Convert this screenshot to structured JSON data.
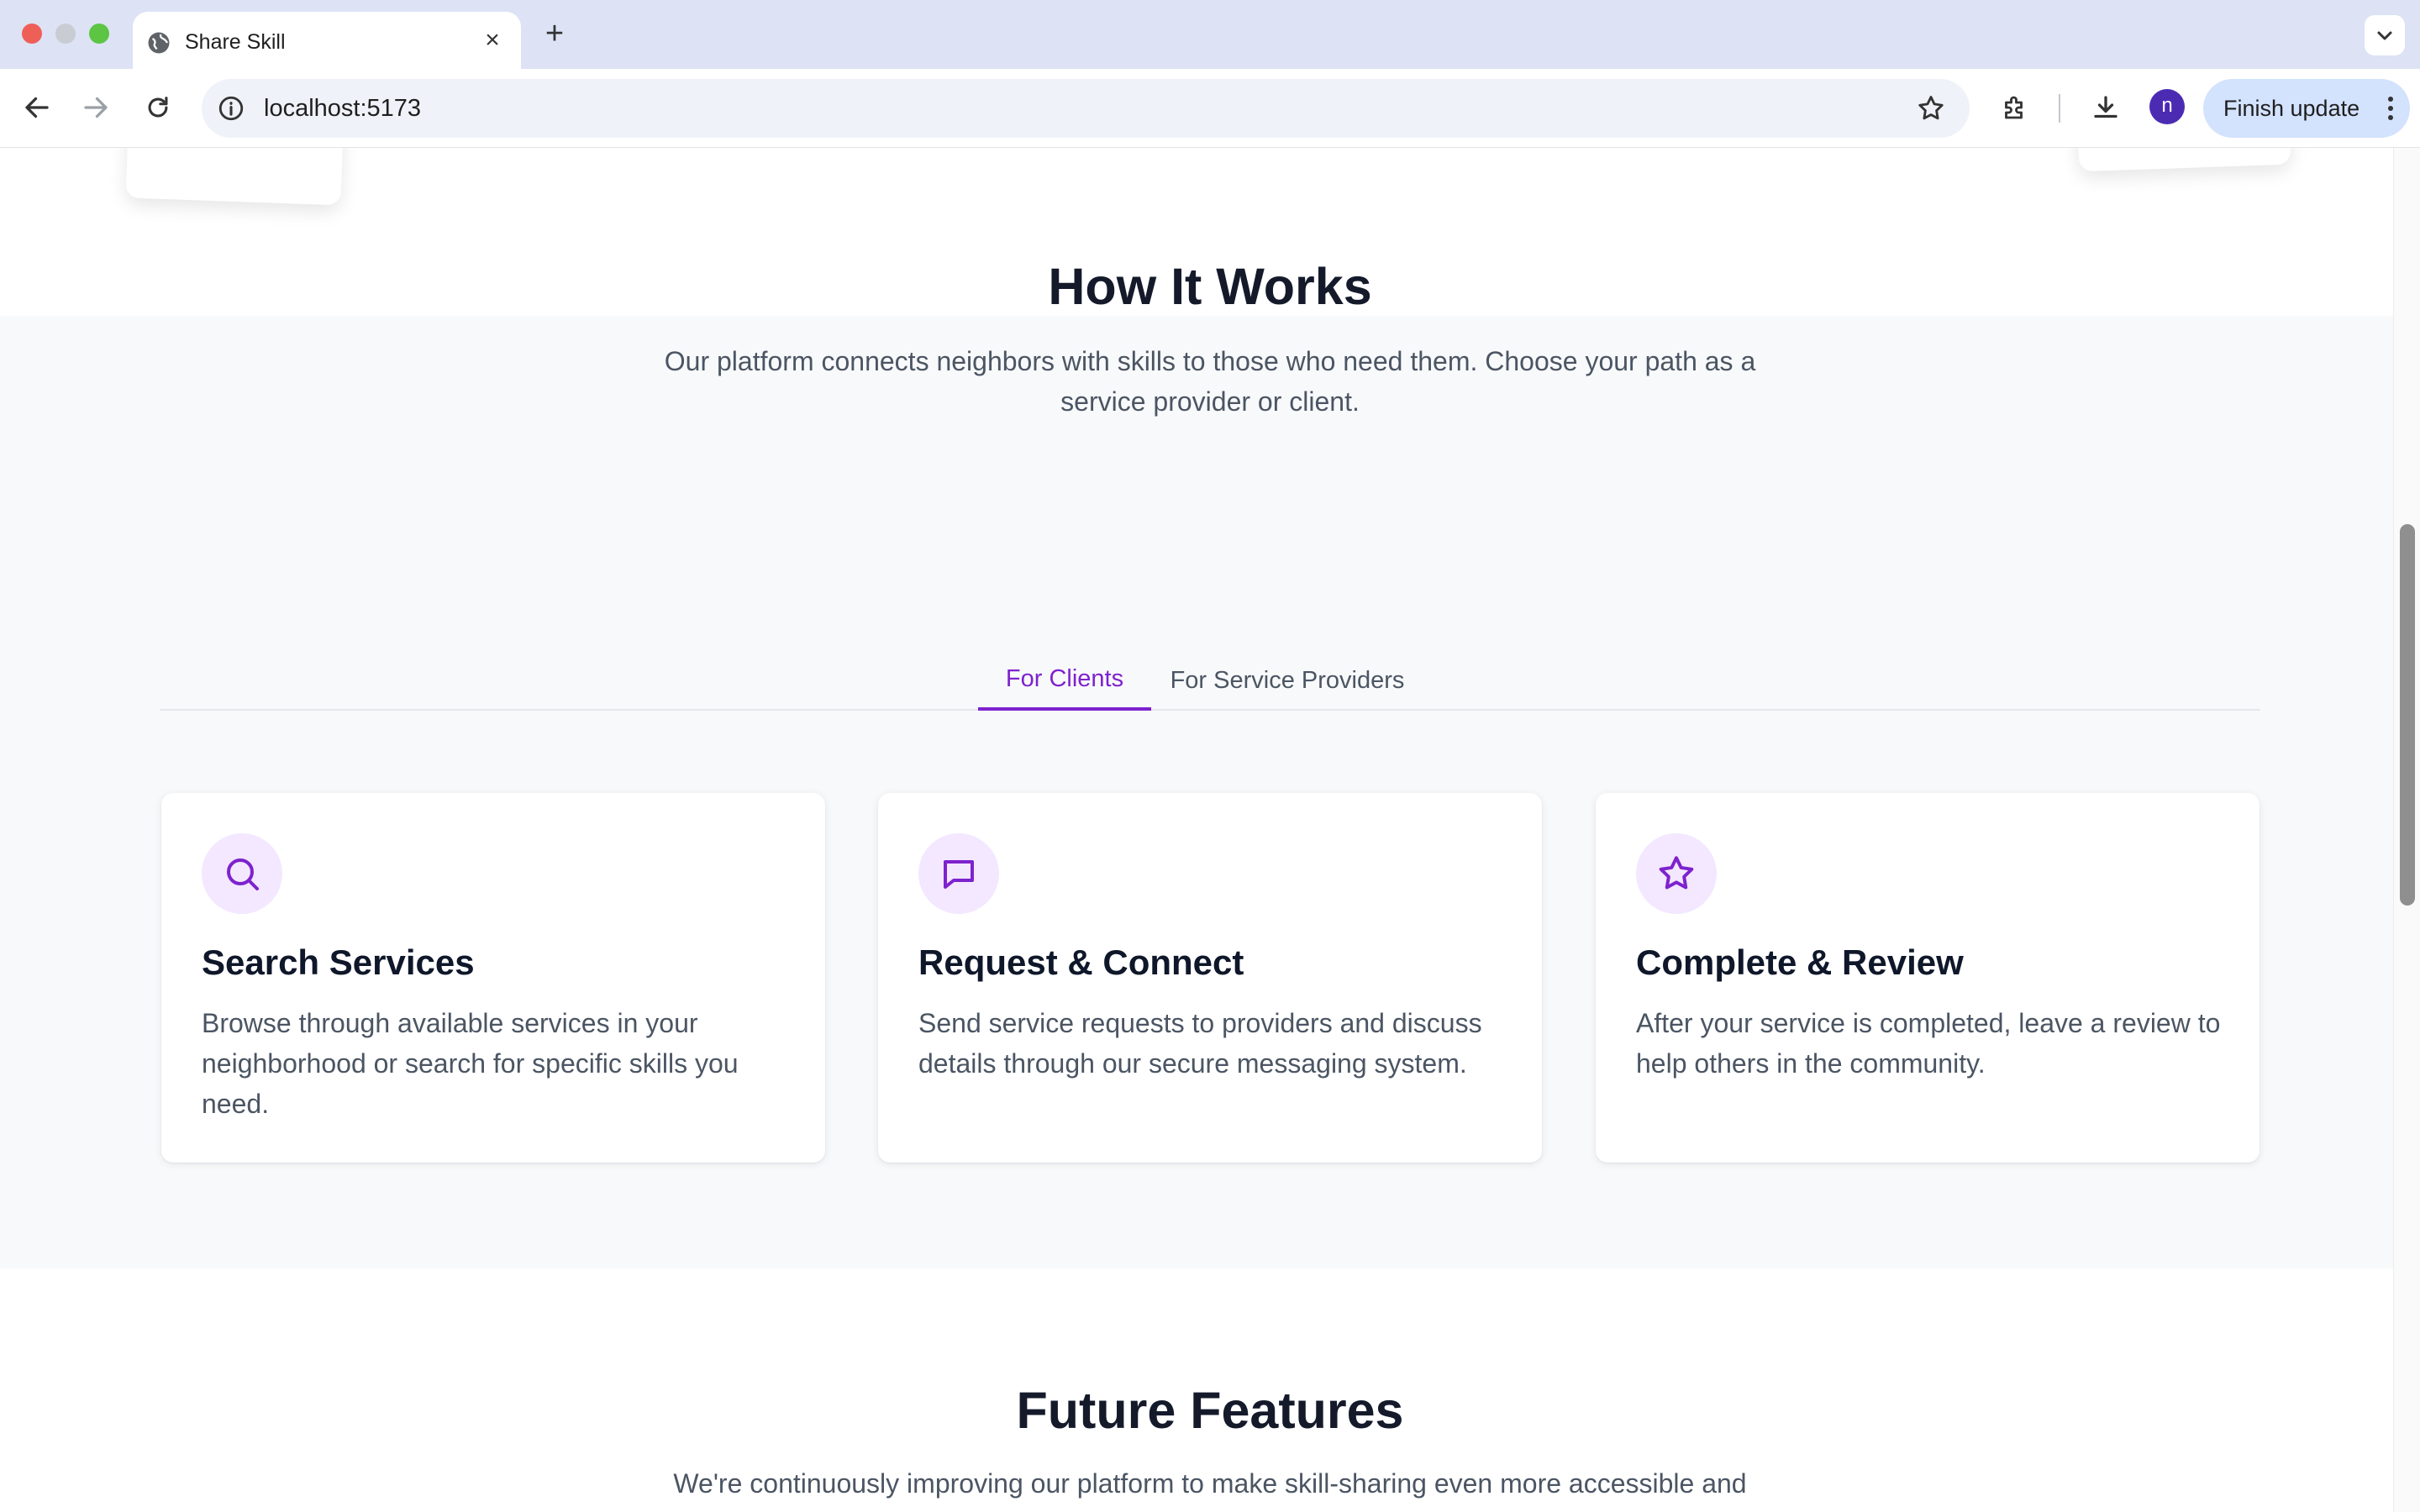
{
  "browser": {
    "tab_title": "Share Skill",
    "url": "localhost:5173",
    "finish_update_label": "Finish update",
    "avatar_letter": "n"
  },
  "how_it_works": {
    "title": "How It Works",
    "subtitle": "Our platform connects neighbors with skills to those who need them. Choose your path as a service provider or client.",
    "tabs": [
      {
        "label": "For Clients",
        "active": true
      },
      {
        "label": "For Service Providers",
        "active": false
      }
    ],
    "cards": [
      {
        "icon": "search-icon",
        "title": "Search Services",
        "description": "Browse through available services in your neighborhood or search for specific skills you need."
      },
      {
        "icon": "message-icon",
        "title": "Request & Connect",
        "description": "Send service requests to providers and discuss details through our secure messaging system."
      },
      {
        "icon": "star-icon",
        "title": "Complete & Review",
        "description": "After your service is completed, leave a review to help others in the community."
      }
    ]
  },
  "future_features": {
    "title": "Future Features",
    "subtitle": "We're continuously improving our platform to make skill-sharing even more accessible and"
  },
  "colors": {
    "accent": "#7e22ce",
    "accent_light": "#f3e8ff",
    "section_bg": "#f8f9fb"
  }
}
